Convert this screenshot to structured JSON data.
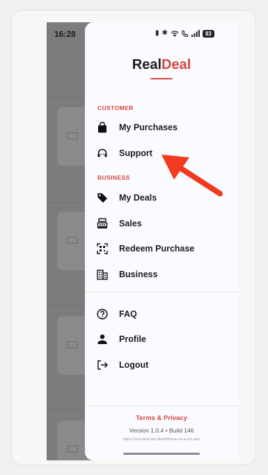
{
  "status_bar": {
    "time": "16:28",
    "battery": "83"
  },
  "app": {
    "logo_primary": "Real",
    "logo_accent": "Deal",
    "accent_color": "#d64540"
  },
  "menu": {
    "customer_header": "CUSTOMER",
    "customer_items": [
      {
        "label": "My Purchases",
        "icon": "shopping-bag-icon"
      },
      {
        "label": "Support",
        "icon": "headset-icon"
      }
    ],
    "business_header": "BUSINESS",
    "business_items": [
      {
        "label": "My Deals",
        "icon": "tag-icon"
      },
      {
        "label": "Sales",
        "icon": "cash-register-icon"
      },
      {
        "label": "Redeem Purchase",
        "icon": "qr-scan-icon"
      },
      {
        "label": "Business",
        "icon": "building-icon"
      }
    ],
    "general_items": [
      {
        "label": "FAQ",
        "icon": "help-circle-icon"
      },
      {
        "label": "Profile",
        "icon": "person-icon"
      },
      {
        "label": "Logout",
        "icon": "logout-icon"
      }
    ]
  },
  "footer": {
    "terms_label": "Terms & Privacy",
    "version": "Version 1.0.4 • Build 146",
    "url": "https://real-deal-api-alazt45wea-ew.a.run.app"
  }
}
